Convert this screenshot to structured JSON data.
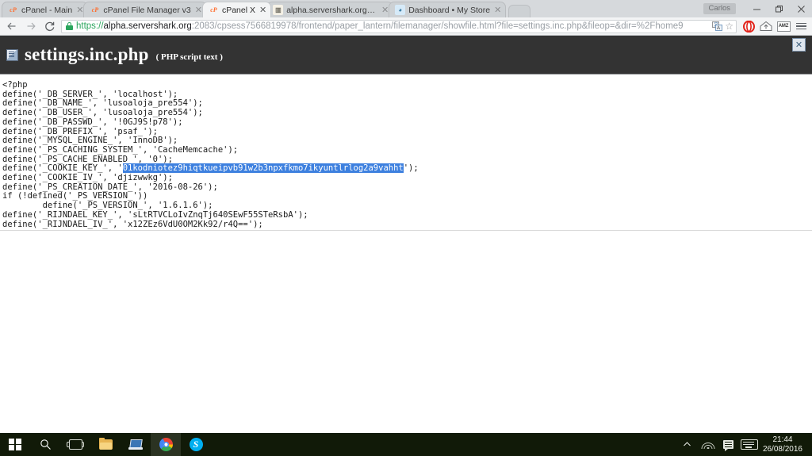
{
  "browser": {
    "tabs": [
      {
        "label": "cPanel - Main",
        "favicon": "cpanel-icon",
        "active": false
      },
      {
        "label": "cPanel File Manager v3",
        "favicon": "cpanel-icon",
        "active": false
      },
      {
        "label": "cPanel X",
        "favicon": "cpanel-icon",
        "active": true
      },
      {
        "label": "alpha.servershark.org / loc",
        "favicon": "phpmyadmin-icon",
        "active": false
      },
      {
        "label": "Dashboard • My Store",
        "favicon": "store-icon",
        "active": false
      }
    ],
    "new_tab_label": "",
    "window": {
      "profile_name": "Carlos",
      "minimize_label": "—",
      "maximize_label": "❐",
      "close_label": "✕"
    },
    "toolbar": {
      "back_label": "←",
      "forward_label": "→",
      "reload_label": "C",
      "url_scheme": "https://",
      "url_host": "alpha.servershark.org",
      "url_path": ":2083/cpsess7566819978/frontend/paper_lantern/filemanager/showfile.html?file=settings.inc.php&fileop=&dir=%2Fhome9",
      "star_label": "☆",
      "extensions": [
        {
          "name": "translate-icon",
          "label": ""
        },
        {
          "name": "opera-icon",
          "label": "O"
        },
        {
          "name": "home-upload-icon",
          "label": ""
        },
        {
          "name": "amz-extension-icon",
          "label": "AMZ"
        }
      ],
      "menu_label": "≡"
    }
  },
  "page": {
    "title": "settings.inc.php",
    "subtitle": "( PHP script text )",
    "close_label": "✕",
    "code": {
      "before_selection": "<?php\ndefine('_DB_SERVER_', 'localhost');\ndefine('_DB_NAME_', 'lusoaloja_pre554');\ndefine('_DB_USER_', 'lusoaloja_pre554');\ndefine('_DB_PASSWD_', '!0GJ9S!p78');\ndefine('_DB_PREFIX_', 'psaf_');\ndefine('_MYSQL_ENGINE_', 'InnoDB');\ndefine('_PS_CACHING_SYSTEM_', 'CacheMemcache');\ndefine('_PS_CACHE_ENABLED_', '0');\ndefine('_COOKIE_KEY_', '",
      "selection": "01kodniotez9hiqtkueipvb91w2b3npxfkmo7ikyuntlrlog2a9vahht",
      "after_selection": "');\ndefine('_COOKIE_IV_', 'djizwwkg');\ndefine('_PS_CREATION_DATE_', '2016-08-26');\nif (!defined('_PS_VERSION_'))\n        define('_PS_VERSION_', '1.6.1.6');\ndefine('_RIJNDAEL_KEY_', 'sLtRTVCLoIvZnqTj640SEwF55STeRsbA');\ndefine('_RIJNDAEL_IV_', 'x12ZEz6VdU0OM2Kk92/r4Q==');"
    }
  },
  "taskbar": {
    "start_label": "",
    "search_label": "⌕",
    "items": [
      {
        "name": "task-view-button",
        "label": ""
      },
      {
        "name": "file-explorer-button",
        "label": ""
      },
      {
        "name": "remote-desktop-button",
        "label": ""
      },
      {
        "name": "chrome-button",
        "label": ""
      },
      {
        "name": "skype-button",
        "label": "S"
      }
    ],
    "tray": {
      "overflow_label": "⌃",
      "time": "21:44",
      "date": "26/08/2016"
    }
  },
  "colors": {
    "page_header_bg": "#333333",
    "selection_blue": "#3d80df",
    "cpanel_orange": "#ff6c2c",
    "taskbar_bg": "#111a08"
  }
}
